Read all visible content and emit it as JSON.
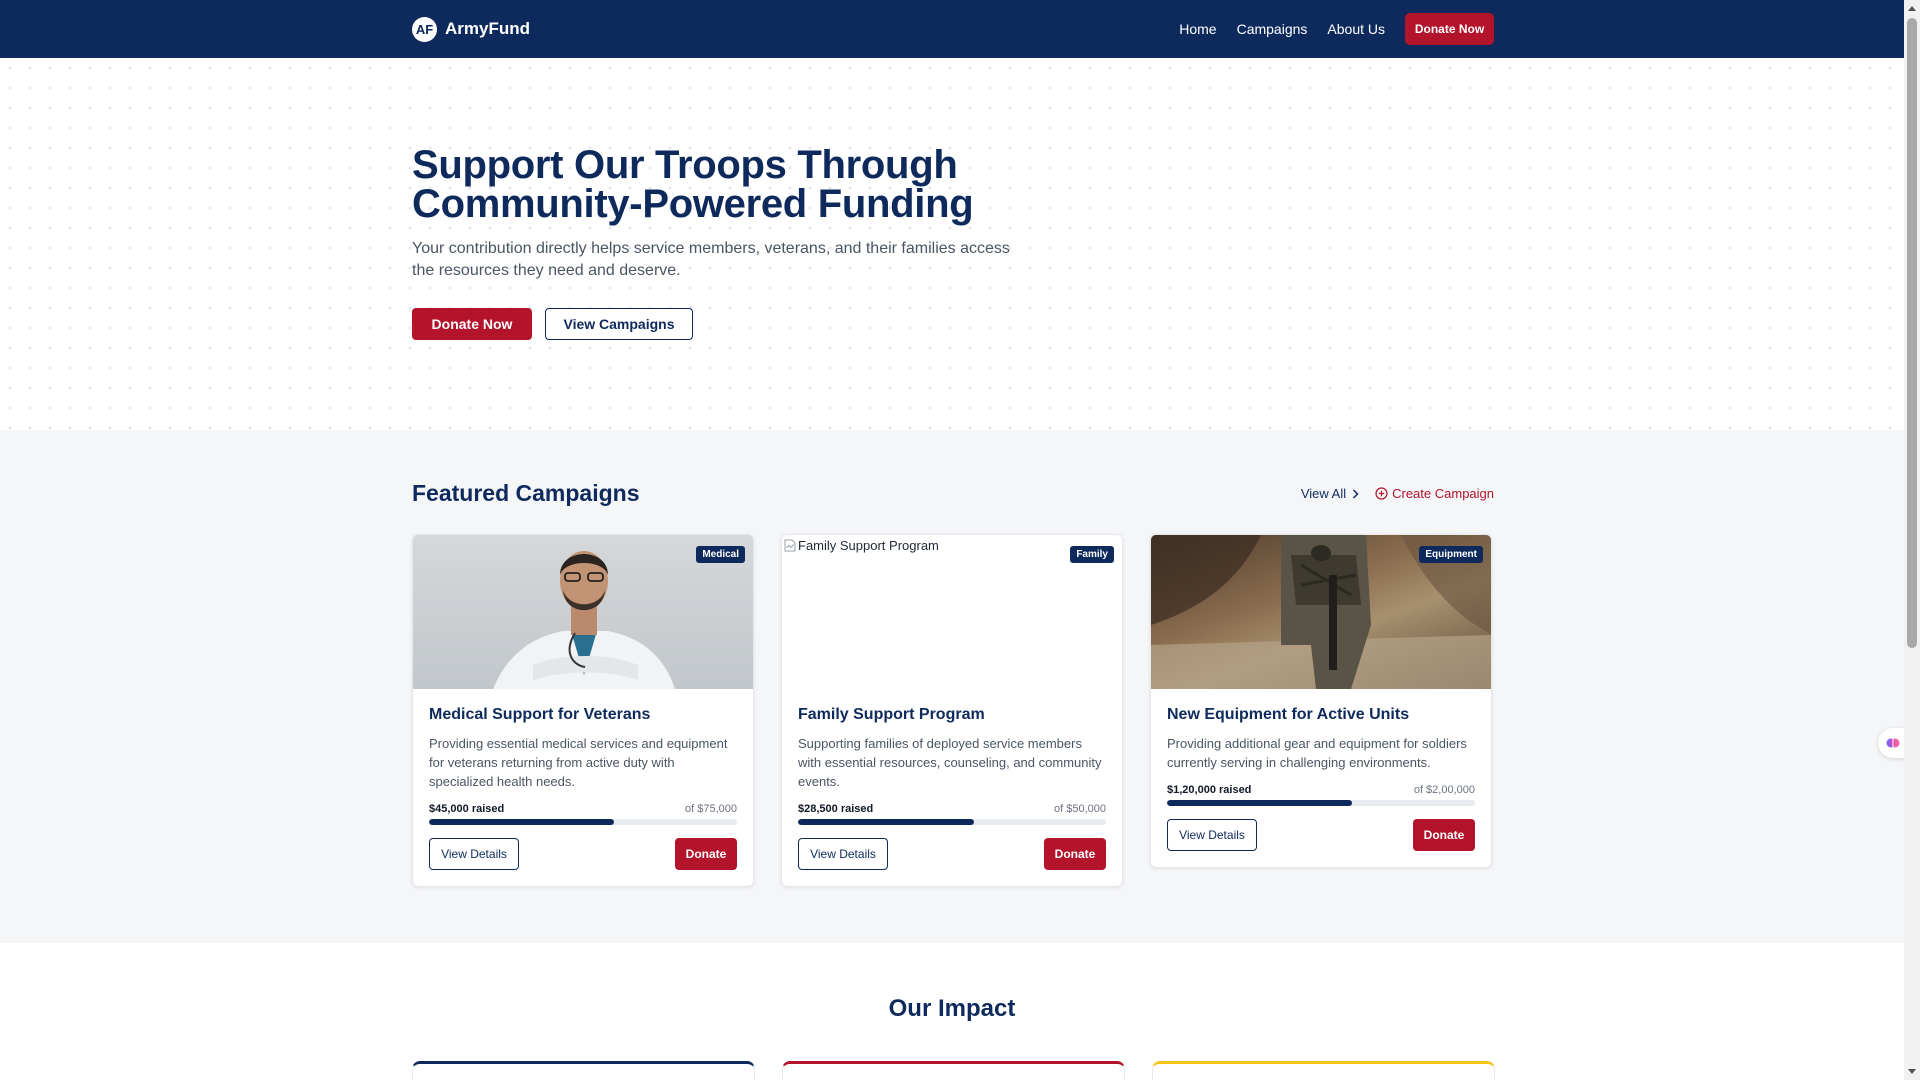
{
  "header": {
    "logo_mark": "AF",
    "brand": "ArmyFund",
    "nav": [
      "Home",
      "Campaigns",
      "About Us"
    ],
    "cta": "Donate Now"
  },
  "hero": {
    "title_line1": "Support Our Troops Through",
    "title_line2": "Community-Powered Funding",
    "subtitle": "Your contribution directly helps service members, veterans, and their families access the resources they need and deserve.",
    "primary": "Donate Now",
    "secondary": "View Campaigns"
  },
  "featured": {
    "title": "Featured Campaigns",
    "view_all": "View All",
    "create": "Create Campaign",
    "cards": [
      {
        "badge": "Medical",
        "title": "Medical Support for Veterans",
        "description": "Providing essential medical services and equipment for veterans returning from active duty with specialized health needs.",
        "raised": "$45,000 raised",
        "goal": "of $75,000",
        "progress": 0.6,
        "details": "View Details",
        "donate": "Donate"
      },
      {
        "badge": "Family",
        "image_alt": "Family Support Program",
        "title": "Family Support Program",
        "description": "Supporting families of deployed service members with essential resources, counseling, and community events.",
        "raised": "$28,500 raised",
        "goal": "of $50,000",
        "progress": 0.57,
        "details": "View Details",
        "donate": "Donate"
      },
      {
        "badge": "Equipment",
        "title": "New Equipment for Active Units",
        "description": "Providing additional gear and equipment for soldiers currently serving in challenging environments.",
        "raised": "$1,20,000 raised",
        "goal": "of $2,00,000",
        "progress": 0.6,
        "details": "View Details",
        "donate": "Donate"
      }
    ]
  },
  "impact": {
    "title": "Our Impact",
    "accent_colors": [
      "#0e2a5c",
      "#b3132b",
      "#f5c518"
    ]
  },
  "colors": {
    "navy": "#0e2a5c",
    "red": "#b3132b",
    "gold": "#f5c518"
  }
}
